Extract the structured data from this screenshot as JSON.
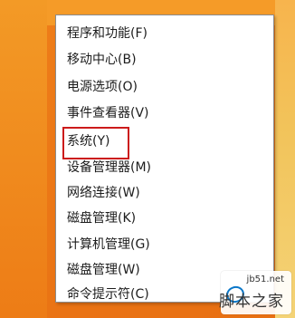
{
  "menu": {
    "items": [
      {
        "label": "程序和功能(F)"
      },
      {
        "label": "移动中心(B)"
      },
      {
        "label": "电源选项(O)"
      },
      {
        "label": "事件查看器(V)"
      },
      {
        "label": "系统(Y)"
      },
      {
        "label": "设备管理器(M)"
      },
      {
        "label": "网络连接(W)"
      },
      {
        "label": "磁盘管理(K)"
      },
      {
        "label": "计算机管理(G)"
      },
      {
        "label": "磁盘管理(W)"
      },
      {
        "label": "命令提示符(C)"
      }
    ],
    "selected_index": 4
  },
  "watermark": {
    "url": "jb51.net",
    "name": "脚本之家"
  },
  "colors": {
    "desktop_orange": "#ef7d14",
    "menu_bg": "#ffffff",
    "highlight_red": "#cc1b1b",
    "watermark_blue": "#0b77c9"
  }
}
